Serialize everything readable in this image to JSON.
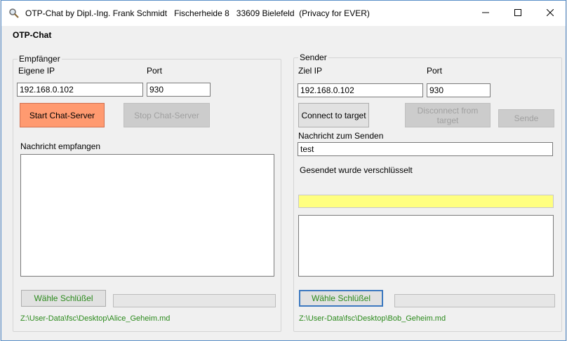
{
  "window": {
    "title": "OTP-Chat by Dipl.-Ing. Frank Schmidt   Fischerheide 8   33609 Bielefeld  (Privacy for EVER)",
    "minimize_icon": "minimize-icon",
    "maximize_icon": "maximize-icon",
    "close_icon": "close-icon"
  },
  "app": {
    "heading": "OTP-Chat"
  },
  "receiver": {
    "group_title": "Empfänger",
    "own_ip_label": "Eigene IP",
    "port_label": "Port",
    "ip_value": "192.168.0.102",
    "port_value": "930",
    "start_button": "Start Chat-Server",
    "stop_button": "Stop Chat-Server",
    "message_label": "Nachricht empfangen",
    "message_value": "",
    "key_button": "Wähle Schlüßel",
    "key_path": "Z:\\User-Data\\fsc\\Desktop\\Alice_Geheim.md"
  },
  "sender": {
    "group_title": "Sender",
    "target_ip_label": "Ziel IP",
    "port_label": "Port",
    "ip_value": "192.168.0.102",
    "port_value": "930",
    "connect_button": "Connect to target",
    "disconnect_button": "Disconnect from target",
    "send_button": "Sende",
    "message_label": "Nachricht zum Senden",
    "message_value": "test",
    "encrypted_label": "Gesendet wurde verschlüsselt",
    "encrypted_value": "",
    "log_value": "",
    "key_button": "Wähle Schlüßel",
    "key_path": "Z:\\User-Data\\fsc\\Desktop\\Bob_Geheim.md"
  },
  "colors": {
    "start_button_bg": "#ff9a70",
    "encrypted_bar_bg": "#ffff80",
    "key_path_text": "#2b8a1c",
    "focus_border": "#3c79c0"
  }
}
